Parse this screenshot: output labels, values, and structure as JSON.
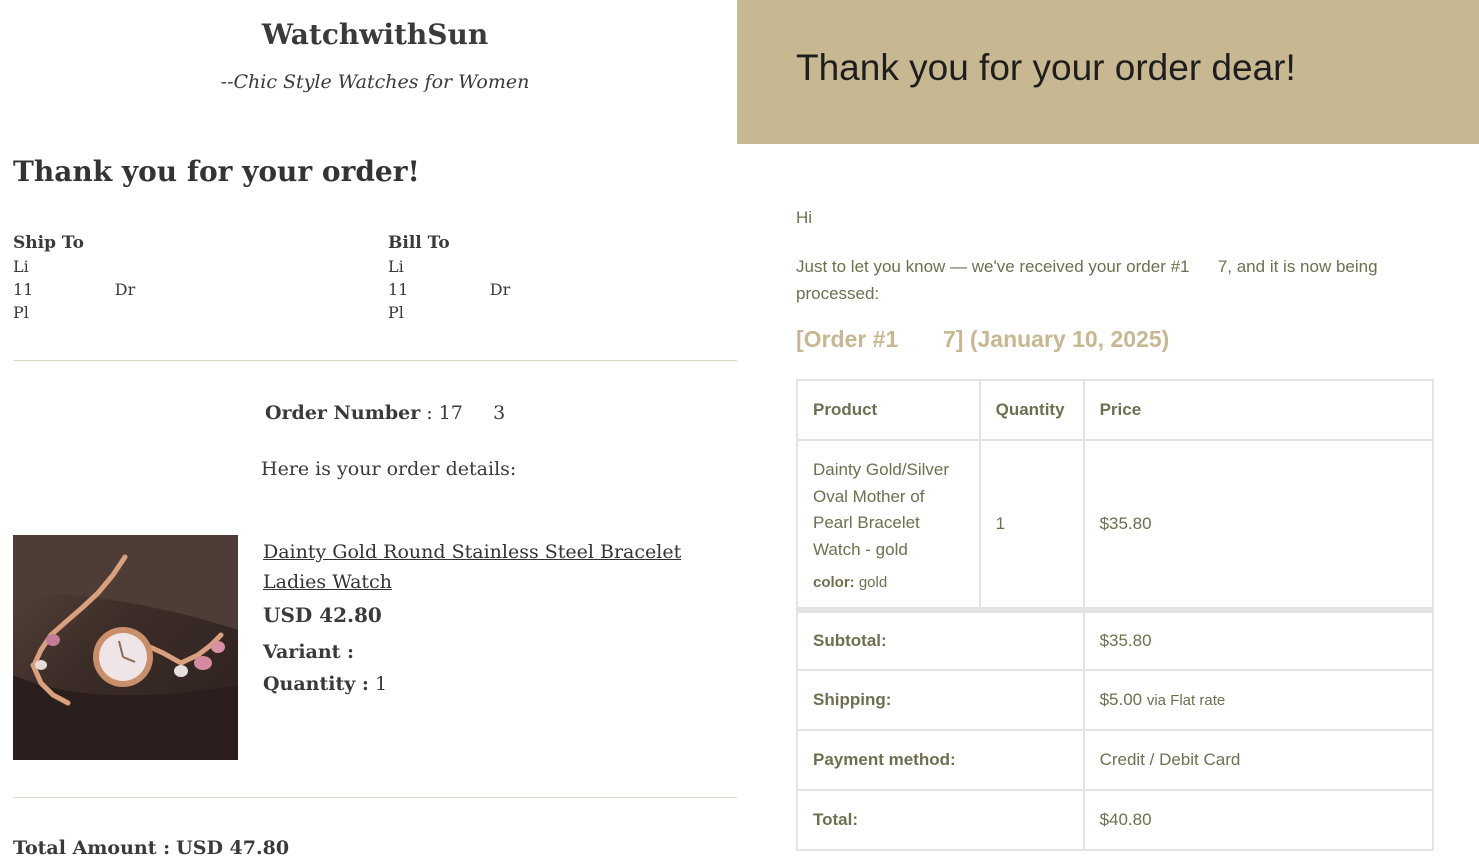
{
  "left_email": {
    "brand": "WatchwithSun",
    "tagline": "--Chic Style Watches for Women",
    "heading": "Thank you for your order!",
    "ship_to": {
      "label": "Ship To",
      "line1": "Li",
      "line2": "11                Dr",
      "line3": "Pl"
    },
    "bill_to": {
      "label": "Bill To",
      "line1": "Li",
      "line2": "11                Dr",
      "line3": "Pl"
    },
    "order_number_label": "Order Number",
    "order_number_value": ": 17     3",
    "details_intro": "Here is your order details:",
    "product": {
      "title": "Dainty Gold Round Stainless Steel Bracelet Ladies Watch",
      "price": "USD 42.80",
      "variant_label": "Variant :",
      "quantity_label": "Quantity :",
      "quantity_value": "1"
    },
    "total_label": "Total Amount :",
    "total_value": "USD 47.80"
  },
  "right_email": {
    "banner_title": "Thank you for your order dear!",
    "greeting": "Hi",
    "intro": "Just to let you know — we've received your order #1      7, and it is now being processed:",
    "order_heading": "[Order #1       7] (January 10, 2025)",
    "table": {
      "headers": [
        "Product",
        "Quantity",
        "Price"
      ],
      "item": {
        "name": "Dainty Gold/Silver Oval Mother of Pearl Bracelet Watch - gold",
        "meta_label": "color:",
        "meta_value": "gold",
        "quantity": "1",
        "price": "$35.80"
      },
      "totals": [
        {
          "label": "Subtotal:",
          "value": "$35.80",
          "note": ""
        },
        {
          "label": "Shipping:",
          "value": "$5.00",
          "note": "via Flat rate"
        },
        {
          "label": "Payment method:",
          "value": "Credit / Debit Card",
          "note": ""
        },
        {
          "label": "Total:",
          "value": "$40.80",
          "note": ""
        }
      ]
    }
  },
  "colors": {
    "banner": "#c7b891",
    "body_text": "#6f6f4f",
    "divider": "#d7dcc2"
  }
}
